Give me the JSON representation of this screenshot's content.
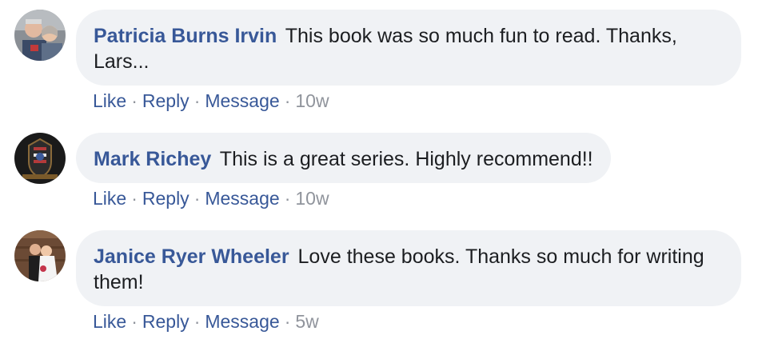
{
  "comments": [
    {
      "author": "Patricia Burns Irvin",
      "text": "This book was so much fun to read. Thanks, Lars...",
      "actions": {
        "like": "Like",
        "reply": "Reply",
        "message": "Message"
      },
      "separator": "·",
      "time": "10w",
      "avatar": "avatar-photo"
    },
    {
      "author": "Mark Richey",
      "text": "This is a great series. Highly recommend!!",
      "actions": {
        "like": "Like",
        "reply": "Reply",
        "message": "Message"
      },
      "separator": "·",
      "time": "10w",
      "avatar": "avatar-emblem"
    },
    {
      "author": "Janice Ryer Wheeler",
      "text": "Love these books. Thanks so much for writing them!",
      "actions": {
        "like": "Like",
        "reply": "Reply",
        "message": "Message"
      },
      "separator": "·",
      "time": "5w",
      "avatar": "avatar-photo"
    }
  ],
  "colors": {
    "link": "#385898",
    "bubble": "#f0f2f5",
    "text": "#1c1e21",
    "meta": "#90949c"
  }
}
